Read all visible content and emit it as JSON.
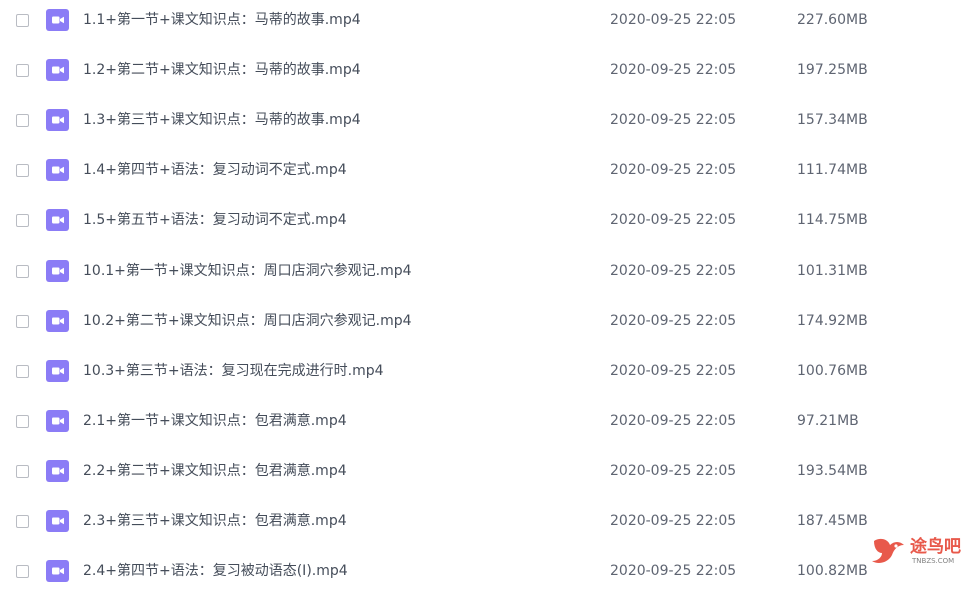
{
  "files": [
    {
      "name": "1.1+第一节+课文知识点：马蒂的故事.mp4",
      "date": "2020-09-25 22:05",
      "size": "227.60MB"
    },
    {
      "name": "1.2+第二节+课文知识点：马蒂的故事.mp4",
      "date": "2020-09-25 22:05",
      "size": "197.25MB"
    },
    {
      "name": "1.3+第三节+课文知识点：马蒂的故事.mp4",
      "date": "2020-09-25 22:05",
      "size": "157.34MB"
    },
    {
      "name": "1.4+第四节+语法：复习动词不定式.mp4",
      "date": "2020-09-25 22:05",
      "size": "111.74MB"
    },
    {
      "name": "1.5+第五节+语法：复习动词不定式.mp4",
      "date": "2020-09-25 22:05",
      "size": "114.75MB"
    },
    {
      "name": "10.1+第一节+课文知识点：周口店洞穴参观记.mp4",
      "date": "2020-09-25 22:05",
      "size": "101.31MB"
    },
    {
      "name": "10.2+第二节+课文知识点：周口店洞穴参观记.mp4",
      "date": "2020-09-25 22:05",
      "size": "174.92MB"
    },
    {
      "name": "10.3+第三节+语法：复习现在完成进行时.mp4",
      "date": "2020-09-25 22:05",
      "size": "100.76MB"
    },
    {
      "name": "2.1+第一节+课文知识点：包君满意.mp4",
      "date": "2020-09-25 22:05",
      "size": "97.21MB"
    },
    {
      "name": "2.2+第二节+课文知识点：包君满意.mp4",
      "date": "2020-09-25 22:05",
      "size": "193.54MB"
    },
    {
      "name": "2.3+第三节+课文知识点：包君满意.mp4",
      "date": "2020-09-25 22:05",
      "size": "187.45MB"
    },
    {
      "name": "2.4+第四节+语法：复习被动语态(I).mp4",
      "date": "2020-09-25 22:05",
      "size": "100.82MB"
    }
  ],
  "icons": {
    "file_icon": "video-file-icon",
    "file_icon_color": "#8b7cf6"
  },
  "watermark": {
    "text": "途鸟吧",
    "url": "TNBZS.COM"
  }
}
